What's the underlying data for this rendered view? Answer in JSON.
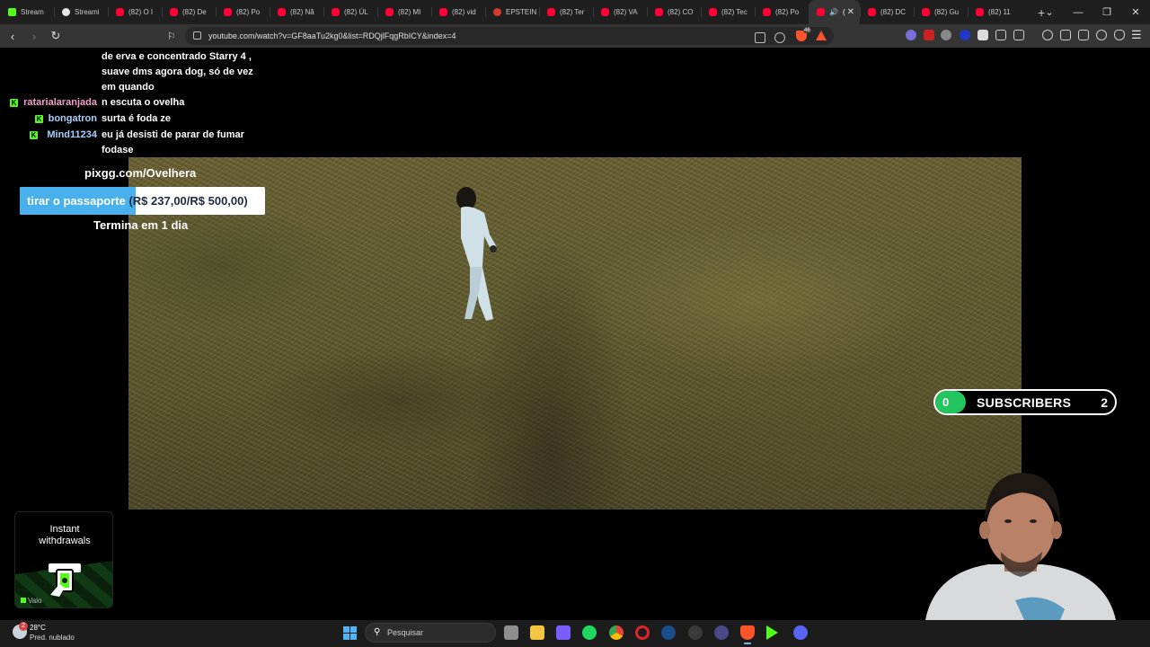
{
  "browser": {
    "tabs": [
      {
        "label": "Stream",
        "favicon": "kick-icon"
      },
      {
        "label": "Streami",
        "favicon": "steam-icon"
      },
      {
        "label": "(82) O I",
        "favicon": "youtube-icon"
      },
      {
        "label": "(82) De",
        "favicon": "youtube-icon"
      },
      {
        "label": "(82) Po",
        "favicon": "youtube-icon"
      },
      {
        "label": "(82) Nã",
        "favicon": "youtube-icon"
      },
      {
        "label": "(82) ÚL",
        "favicon": "youtube-icon"
      },
      {
        "label": "(82) MI",
        "favicon": "youtube-icon"
      },
      {
        "label": "(82) vid",
        "favicon": "youtube-icon"
      },
      {
        "label": "EPSTEIN",
        "favicon": "record-icon"
      },
      {
        "label": "(82) Ter",
        "favicon": "youtube-icon"
      },
      {
        "label": "(82) VA",
        "favicon": "youtube-icon"
      },
      {
        "label": "(82) CO",
        "favicon": "youtube-icon"
      },
      {
        "label": "(82) Tec",
        "favicon": "youtube-icon"
      },
      {
        "label": "(82) Po",
        "favicon": "youtube-icon"
      },
      {
        "label": "(",
        "favicon": "youtube-icon",
        "active": true
      },
      {
        "label": "(82) DC",
        "favicon": "youtube-icon"
      },
      {
        "label": "(82) Gu",
        "favicon": "youtube-icon"
      },
      {
        "label": "(82) 11",
        "favicon": "youtube-icon"
      }
    ],
    "new_tab_glyph": "+",
    "url": "youtube.com/watch?v=GF8aaTu2kg0&list=RDQjlFqgRbICY&index=4",
    "brave_badge": "46"
  },
  "chat": {
    "continuation": [
      "de erva e concentrado Starry 4 ,",
      "suave dms agora dog, só de vez",
      "em quando"
    ],
    "messages": [
      {
        "user": "ratarialaranjada",
        "user_color": "#f0a0c8",
        "text": "n escuta o ovelha"
      },
      {
        "user": "bongatron",
        "user_color": "#a6d0ff",
        "text": "surta é foda ze"
      },
      {
        "user": "Mind11234",
        "user_color": "#a6d0ff",
        "text": "eu já desisti de parar de fumar",
        "text2": "fodase"
      }
    ]
  },
  "donation": {
    "link": "pixgg.com/Ovelhera",
    "goal_title": "tirar o passaporte",
    "goal_amount": "(R$ 237,00/R$ 500,00)",
    "progress": 0.474,
    "ends": "Termina em 1 dia"
  },
  "subscribers": {
    "current": "0",
    "label": "SUBSCRIBERS",
    "goal": "2",
    "accent": "#22c55e"
  },
  "ad": {
    "line1": "Instant",
    "line2": "withdrawals",
    "brand": "Valo"
  },
  "taskbar": {
    "weather_temp": "28°C",
    "weather_desc": "Pred. nublado",
    "weather_badge": "2",
    "search_placeholder": "Pesquisar"
  }
}
